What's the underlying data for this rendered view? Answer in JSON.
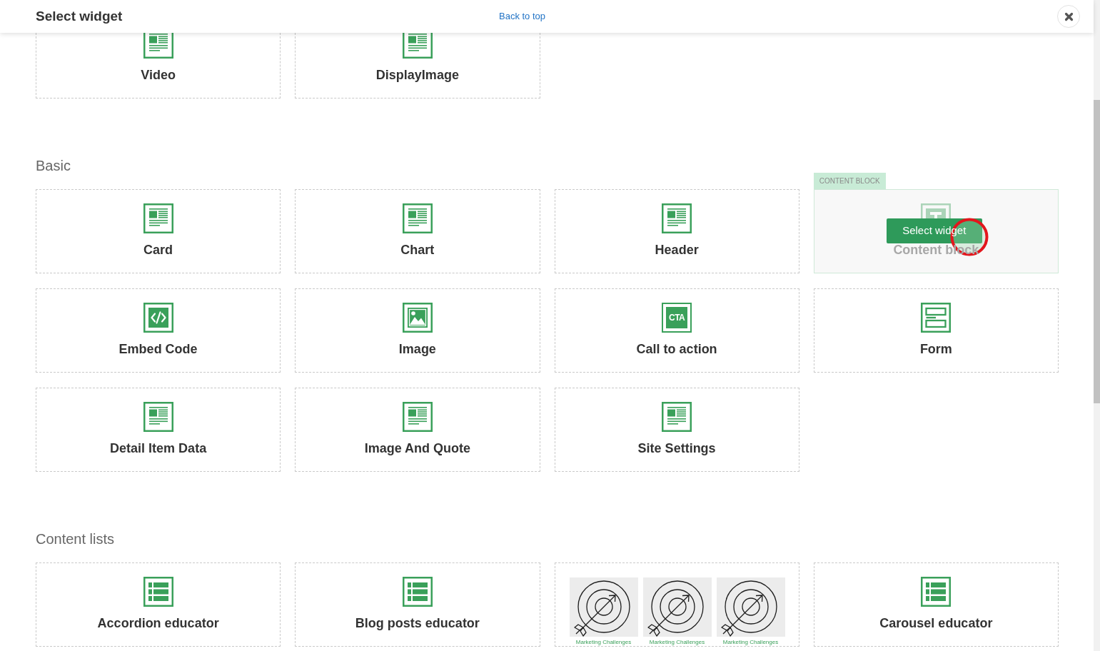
{
  "header": {
    "title": "Select widget",
    "back_link": "Back to top"
  },
  "sections": [
    {
      "tiles": [
        {
          "kind": "article",
          "label": "Video",
          "hovered": false
        },
        {
          "kind": "article",
          "label": "DisplayImage",
          "hovered": false
        }
      ]
    },
    {
      "title": "Basic",
      "tiles": [
        {
          "kind": "article",
          "label": "Card",
          "hovered": false
        },
        {
          "kind": "article",
          "label": "Chart",
          "hovered": false
        },
        {
          "kind": "article",
          "label": "Header",
          "hovered": false
        },
        {
          "kind": "text",
          "label": "Content block",
          "hovered": true,
          "tag": "CONTENT BLOCK",
          "action": "Select widget"
        },
        {
          "kind": "code",
          "label": "Embed Code",
          "hovered": false
        },
        {
          "kind": "image",
          "label": "Image",
          "hovered": false
        },
        {
          "kind": "cta",
          "icon_text": "CTA",
          "label": "Call to action",
          "hovered": false
        },
        {
          "kind": "form",
          "label": "Form",
          "hovered": false
        },
        {
          "kind": "article",
          "label": "Detail Item Data",
          "hovered": false
        },
        {
          "kind": "article",
          "label": "Image And Quote",
          "hovered": false
        },
        {
          "kind": "article",
          "label": "Site Settings",
          "hovered": false
        }
      ]
    },
    {
      "title": "Content lists",
      "tiles": [
        {
          "kind": "list",
          "label": "Accordion educator",
          "hovered": false
        },
        {
          "kind": "list",
          "label": "Blog posts educator",
          "hovered": false
        },
        {
          "kind": "preview",
          "hovered": false,
          "cards": [
            {
              "caption": "Marketing Challenges"
            },
            {
              "caption": "Marketing Challenges"
            },
            {
              "caption": "Marketing Challenges"
            }
          ]
        },
        {
          "kind": "list",
          "label": "Carousel educator",
          "hovered": false
        }
      ]
    }
  ],
  "click_marker": true
}
